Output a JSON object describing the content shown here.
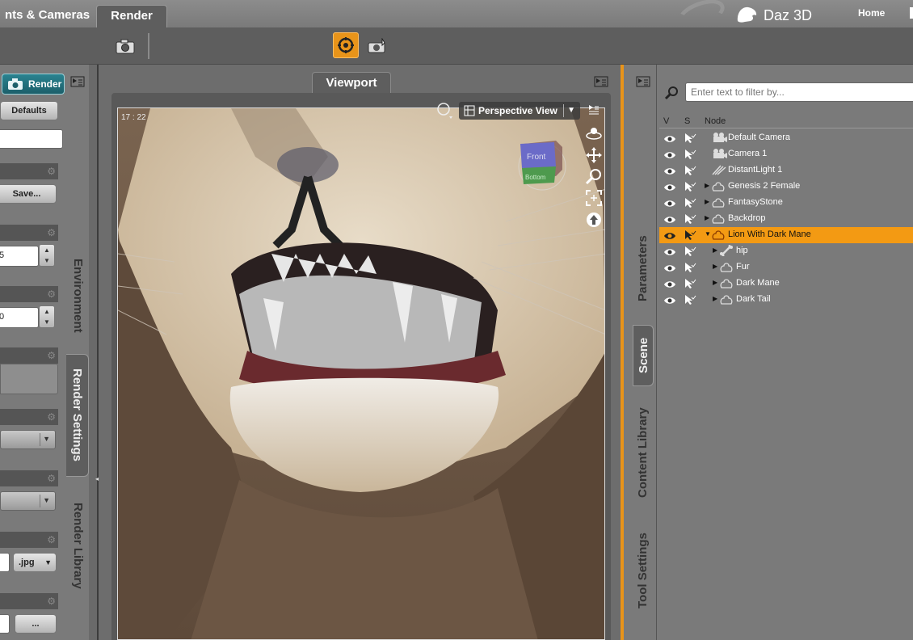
{
  "app": {
    "brand": "Daz 3D",
    "home_link": "Home"
  },
  "top_tabs": [
    {
      "label": "nts & Cameras"
    },
    {
      "label": "Render"
    }
  ],
  "toolbar": {
    "icons": [
      "camera-icon",
      "iray-interactive-icon",
      "camera-preview-icon"
    ]
  },
  "left_panel": {
    "render_button": "Render",
    "defaults_button": "Defaults",
    "save_button": "Save...",
    "spin1_value": "5",
    "spin2_value": "0",
    "format_value": ".jpg",
    "browse_button": "..."
  },
  "left_tabs": [
    "Environment",
    "Render Settings",
    "Render Library"
  ],
  "viewport": {
    "title": "Viewport",
    "time": "17 : 22",
    "view_mode": "Perspective View",
    "cube_labels": {
      "front": "Front",
      "bottom": "Bottom"
    }
  },
  "right_tabs": [
    "Parameters",
    "Scene",
    "Content Library",
    "Tool Settings"
  ],
  "scene": {
    "filter_placeholder": "Enter text to filter by...",
    "columns": {
      "v": "V",
      "s": "S",
      "node": "Node"
    },
    "nodes": [
      {
        "label": "Default Camera",
        "icon": "camera-icon",
        "depth": 0,
        "expandable": false
      },
      {
        "label": "Camera 1",
        "icon": "camera-icon",
        "depth": 0,
        "expandable": false
      },
      {
        "label": "DistantLight 1",
        "icon": "light-icon",
        "depth": 0,
        "expandable": false
      },
      {
        "label": "Genesis 2 Female",
        "icon": "figure-icon",
        "depth": 0,
        "expandable": true
      },
      {
        "label": "FantasyStone",
        "icon": "figure-icon",
        "depth": 0,
        "expandable": true
      },
      {
        "label": "Backdrop",
        "icon": "figure-icon",
        "depth": 0,
        "expandable": true
      },
      {
        "label": "Lion With Dark Mane",
        "icon": "figure-icon",
        "depth": 0,
        "expandable": true,
        "expanded": true,
        "selected": true
      },
      {
        "label": "hip",
        "icon": "bone-icon",
        "depth": 1,
        "expandable": true
      },
      {
        "label": "Fur",
        "icon": "figure-icon",
        "depth": 1,
        "expandable": true
      },
      {
        "label": "Dark Mane",
        "icon": "figure-icon",
        "depth": 1,
        "expandable": true
      },
      {
        "label": "Dark Tail",
        "icon": "figure-icon",
        "depth": 1,
        "expandable": true
      }
    ]
  },
  "colors": {
    "accent": "#f39a13",
    "render_button": "#1c5f6a",
    "panel": "#7a7a7a"
  }
}
